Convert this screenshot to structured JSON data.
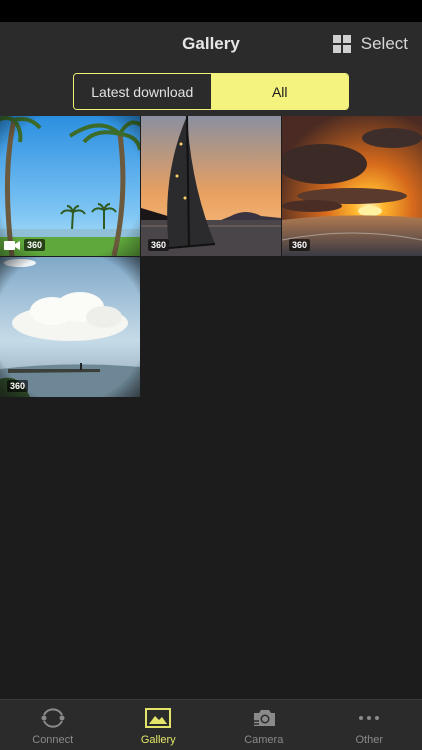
{
  "header": {
    "title": "Gallery",
    "select_label": "Select"
  },
  "segments": {
    "latest_label": "Latest download",
    "all_label": "All",
    "selected": "All"
  },
  "thumbnails": [
    {
      "subject": "palm trees on lawn",
      "badge": "360",
      "video": true
    },
    {
      "subject": "sailboat at sunset",
      "badge": "360",
      "video": false
    },
    {
      "subject": "sunset clouds over sea",
      "badge": "360",
      "video": false
    },
    {
      "subject": "clouds over harbor",
      "badge": "360",
      "video": false
    }
  ],
  "tabbar": {
    "items": [
      {
        "label": "Connect",
        "icon": "connect-icon",
        "active": false
      },
      {
        "label": "Gallery",
        "icon": "gallery-icon",
        "active": true
      },
      {
        "label": "Camera",
        "icon": "camera-icon",
        "active": false
      },
      {
        "label": "Other",
        "icon": "more-icon",
        "active": false
      }
    ]
  },
  "colors": {
    "accent": "#f3f37e",
    "active_tab": "#e4e46b",
    "background": "#1c1c1c",
    "bar": "#2b2b2b"
  }
}
